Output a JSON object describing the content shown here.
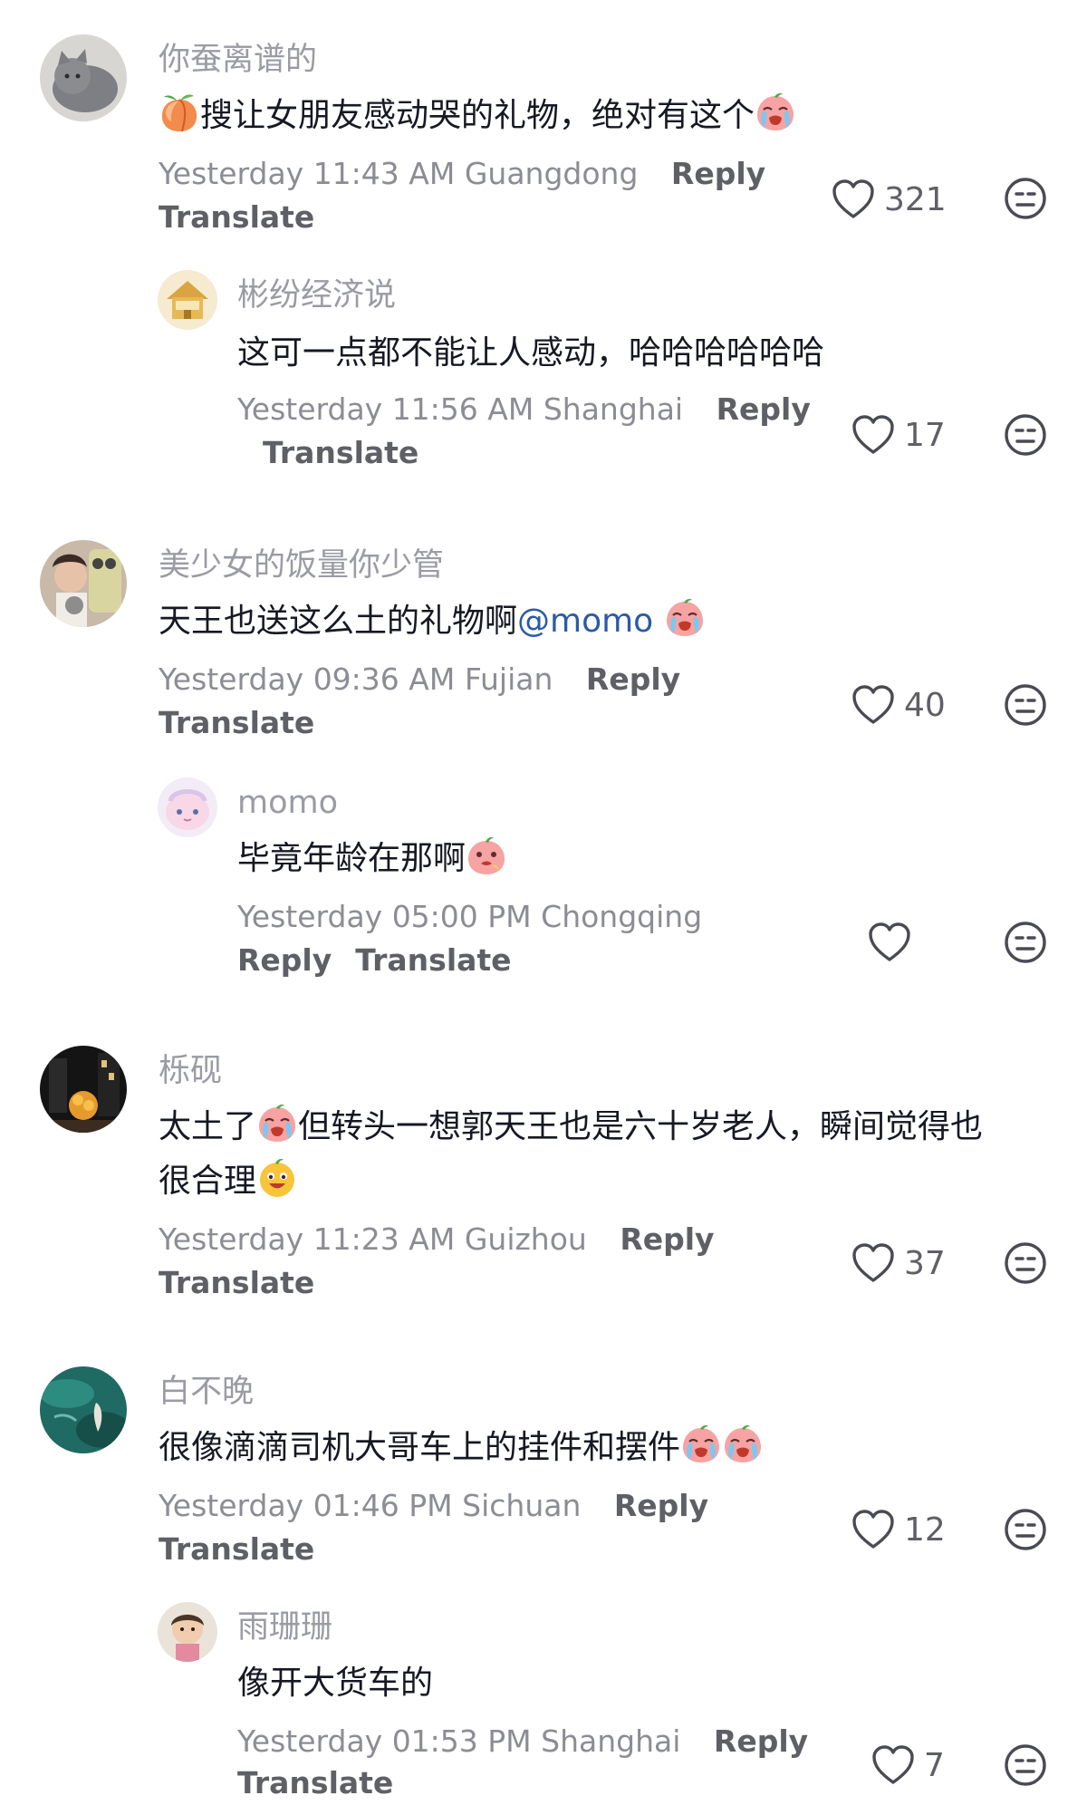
{
  "comments": [
    {
      "username": "你蚕离谱的",
      "text_before": "搜让女朋友感动哭的礼物，绝对有这个",
      "time": "Yesterday 11:43 AM",
      "location": "Guangdong",
      "reply_label": "Reply",
      "translate_label": "Translate",
      "likes": "321",
      "avatar_icon": "cat-avatar"
    },
    {
      "username": "彬纷经济说",
      "text": "这可一点都不能让人感动，哈哈哈哈哈哈",
      "time": "Yesterday 11:56 AM",
      "location": "Shanghai",
      "reply_label": "Reply",
      "translate_label": "Translate",
      "likes": "17",
      "avatar_icon": "house-avatar"
    },
    {
      "username": "美少女的饭量你少管",
      "text": "天王也送这么土的礼物啊",
      "mention": "@momo",
      "time": "Yesterday 09:36 AM",
      "location": "Fujian",
      "reply_label": "Reply",
      "translate_label": "Translate",
      "likes": "40",
      "avatar_icon": "selfie-avatar"
    },
    {
      "username": "momo",
      "text": "毕竟年龄在那啊",
      "time": "Yesterday 05:00 PM",
      "location": "Chongqing",
      "reply_label": "Reply",
      "translate_label": "Translate",
      "likes": "",
      "avatar_icon": "pink-face-avatar"
    },
    {
      "username": "栎砚",
      "text_line1": "太土了",
      "text_line1b": "但转头一想郭天王也是六十岁老人，瞬间觉得也",
      "text_line2": "很合理",
      "time": "Yesterday 11:23 AM",
      "location": "Guizhou",
      "reply_label": "Reply",
      "translate_label": "Translate",
      "likes": "37",
      "avatar_icon": "night-scene-avatar"
    },
    {
      "username": "白不晚",
      "text": "很像滴滴司机大哥车上的挂件和摆件",
      "time": "Yesterday 01:46 PM",
      "location": "Sichuan",
      "reply_label": "Reply",
      "translate_label": "Translate",
      "likes": "12",
      "avatar_icon": "water-avatar"
    },
    {
      "username": "雨珊珊",
      "text": "像开大货车的",
      "time": "Yesterday 01:53 PM",
      "location": "Shanghai",
      "reply_label": "Reply",
      "translate_label": "Translate",
      "likes": "7",
      "avatar_icon": "child-avatar"
    }
  ],
  "colors": {
    "username": "#9a9ba3",
    "text": "#161823",
    "meta": "#8c8d94",
    "action": "#5f6066",
    "mention": "#2b5aa6"
  }
}
